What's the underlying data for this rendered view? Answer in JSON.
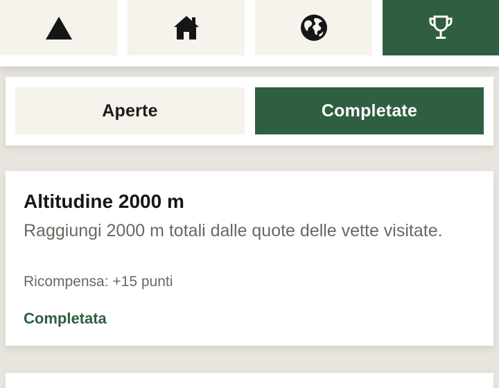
{
  "nav": {
    "tabs": [
      {
        "icon": "mountain-icon",
        "active": false
      },
      {
        "icon": "home-icon",
        "active": false
      },
      {
        "icon": "globe-icon",
        "active": false
      },
      {
        "icon": "trophy-icon",
        "active": true
      }
    ]
  },
  "segment": {
    "open_label": "Aperte",
    "completed_label": "Completate",
    "selected": "completed"
  },
  "achievement": {
    "title": "Altitudine 2000 m",
    "description": "Raggiungi 2000 m totali dalle quote delle vette visitate.",
    "reward": "Ricompensa: +15 punti",
    "status": "Completata"
  },
  "colors": {
    "accent": "#2f5e40",
    "tab_bg": "#f5f3ec",
    "page_bg": "#e8e6df",
    "muted_text": "#686862"
  }
}
